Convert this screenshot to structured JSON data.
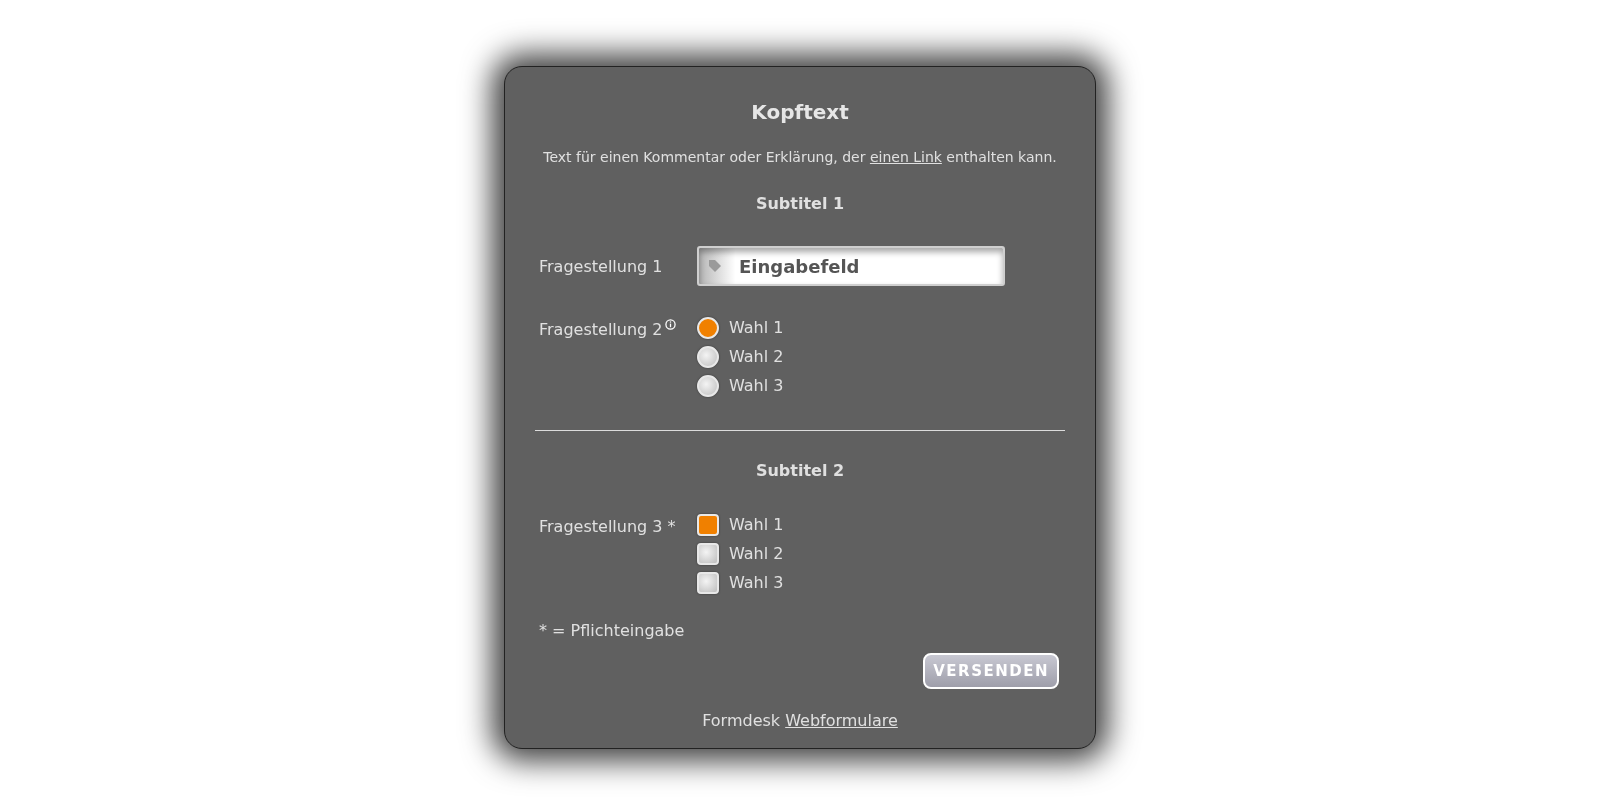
{
  "title": "Kopftext",
  "intro": {
    "before": "Text für einen Kommentar oder Erklärung, der ",
    "link": "einen Link",
    "after": " enthalten kann."
  },
  "sections": [
    {
      "subtitle": "Subtitel 1",
      "questions": [
        {
          "kind": "text",
          "label": "Fragestellung 1",
          "value": "Eingabefeld"
        },
        {
          "kind": "radio",
          "label": "Fragestellung 2",
          "info": true,
          "options": [
            {
              "label": "Wahl 1",
              "selected": true
            },
            {
              "label": "Wahl 2",
              "selected": false
            },
            {
              "label": "Wahl 3",
              "selected": false
            }
          ]
        }
      ]
    },
    {
      "subtitle": "Subtitel 2",
      "questions": [
        {
          "kind": "checkbox",
          "label": "Fragestellung 3 *",
          "info": false,
          "options": [
            {
              "label": "Wahl 1",
              "checked": true
            },
            {
              "label": "Wahl 2",
              "checked": false
            },
            {
              "label": "Wahl 3",
              "checked": false
            }
          ]
        }
      ]
    }
  ],
  "required_note": "* = Pflichteingabe",
  "submit": "VERSENDEN",
  "footer": {
    "text": "Formdesk ",
    "link": "Webformulare"
  }
}
